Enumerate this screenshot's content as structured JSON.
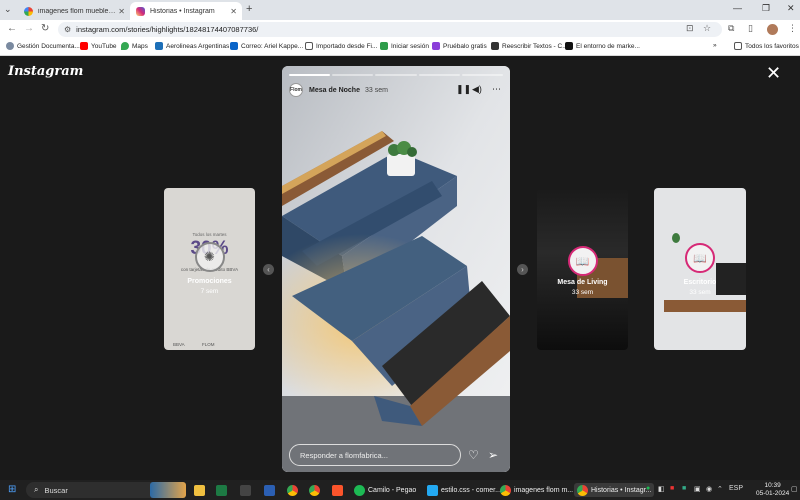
{
  "browser": {
    "tabs": [
      {
        "label": "imagenes flom muebles - Busca",
        "active": false
      },
      {
        "label": "Historias • Instagram",
        "active": true
      }
    ],
    "url": "instagram.com/stories/highlights/18248174407087736/",
    "bookmarks": [
      {
        "label": "Gestión Documenta..."
      },
      {
        "label": "YouTube"
      },
      {
        "label": "Maps"
      },
      {
        "label": "Aerolineas Argentinas"
      },
      {
        "label": "Correo: Ariel Kappe..."
      },
      {
        "label": "Importado desde Fi..."
      },
      {
        "label": "Iniciar sesión"
      },
      {
        "label": "Pruébalo gratis"
      },
      {
        "label": "Reescribir Textos - C..."
      },
      {
        "label": "El entorno de marke..."
      }
    ],
    "all_favorites": "Todos los favoritos"
  },
  "instagram": {
    "logo": "Instagram",
    "main_story": {
      "username": "Mesa de Noche",
      "time": "33 sem",
      "reply_placeholder": "Responder a flomfabrica...",
      "avatar_text": "Flom"
    },
    "side_stories": [
      {
        "name": "Promociones",
        "time": "7 sem"
      },
      {
        "name": "Mesa de Living",
        "time": "33 sem"
      },
      {
        "name": "Escritorio",
        "time": "33 sem"
      }
    ],
    "promo_text": {
      "line1": "Todos los martes",
      "big": "30%",
      "line2": "con tarjetas de crédito BBVA",
      "logos": [
        "BBVA",
        "FLOM"
      ]
    }
  },
  "taskbar": {
    "search": "Buscar",
    "items": [
      {
        "label": "Camilo - Pegao"
      },
      {
        "label": "estilo.css - comer..."
      },
      {
        "label": "imagenes flom m..."
      },
      {
        "label": "Historias • Instagr..."
      }
    ],
    "lang": "ESP",
    "time": "10:39",
    "date": "05-01-2024"
  },
  "colors": {
    "accent_ring": "#d62976",
    "viewer_bg": "#1a1a1a",
    "drawer_blue": "#4a6384",
    "wood": "#8a5a36"
  }
}
